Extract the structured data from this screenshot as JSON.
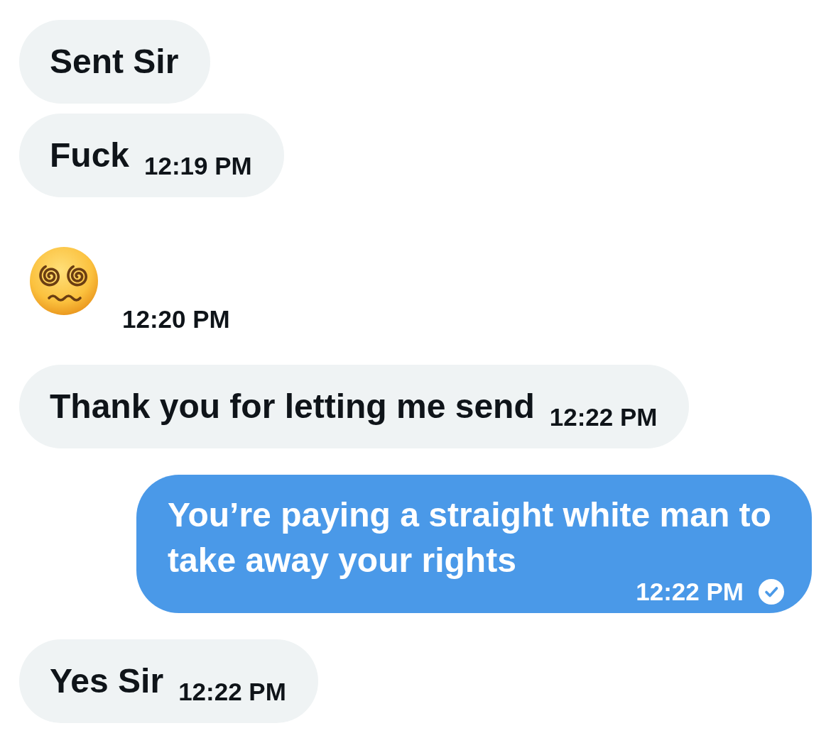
{
  "messages": [
    {
      "kind": "text",
      "sent": false,
      "text": "Sent Sir"
    },
    {
      "kind": "text",
      "sent": false,
      "text": "Fuck",
      "time": "12:19 PM"
    },
    {
      "kind": "emoji",
      "time": "12:20 PM"
    },
    {
      "kind": "text",
      "sent": false,
      "text": "Thank you for letting me send",
      "time": "12:22 PM"
    },
    {
      "kind": "text",
      "sent": true,
      "text": "You’re paying a straight white man to take away your rights",
      "time": "12:22 PM",
      "read": true
    },
    {
      "kind": "text",
      "sent": false,
      "text": "Yes Sir",
      "time": "12:22 PM"
    }
  ]
}
